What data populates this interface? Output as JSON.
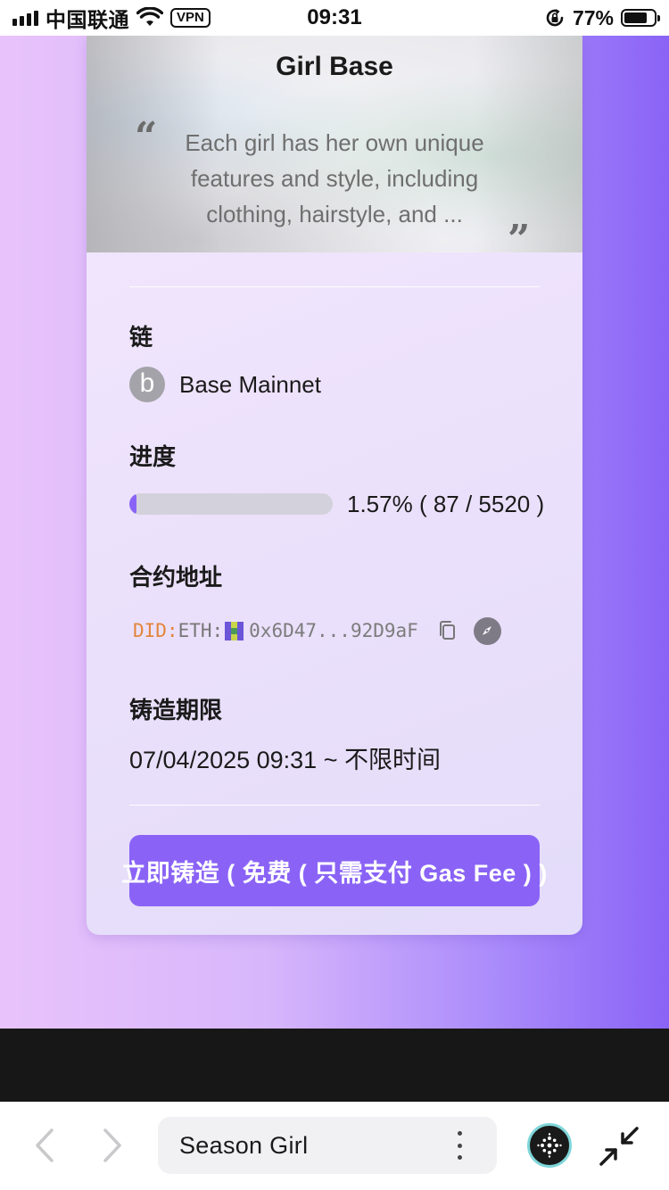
{
  "status_bar": {
    "carrier": "中国联通",
    "vpn": "VPN",
    "time": "09:31",
    "battery": "77%",
    "battery_level": 0.77
  },
  "card": {
    "title": "Girl Base",
    "description": "Each girl has her own unique features and style, including clothing, hairstyle, and ...",
    "chain": {
      "label": "链",
      "icon_letter": "b",
      "name": "Base Mainnet"
    },
    "progress": {
      "label": "进度",
      "fraction": 0.0157,
      "text": "1.57% ( 87 / 5520 )"
    },
    "contract": {
      "label": "合约地址",
      "did_prefix": "DID:",
      "eth_prefix": "ETH:",
      "address": "0x6D47...92D9aF"
    },
    "mint_period": {
      "label": "铸造期限",
      "value": "07/04/2025 09:31 ~ 不限时间"
    },
    "mint_button": "立即铸造 ( 免费 ( 只需支付 Gas Fee ) )"
  },
  "browser": {
    "page_title": "Season Girl"
  },
  "colors": {
    "accent": "#8a63f6",
    "did_orange": "#e2853c"
  }
}
